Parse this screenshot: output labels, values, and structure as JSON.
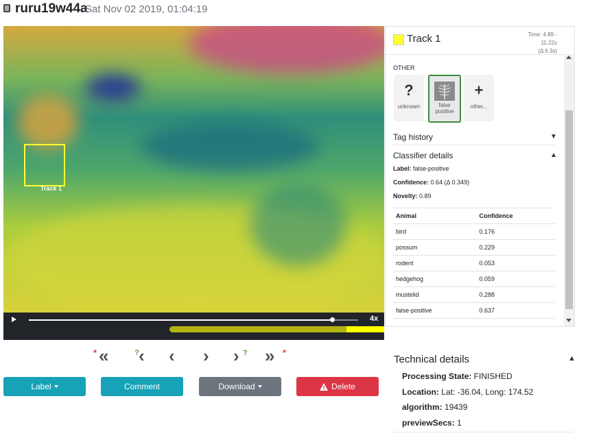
{
  "header": {
    "title": "ruru19w44a",
    "date": "Sat Nov 02 2019, 01:04:19"
  },
  "video": {
    "track_label": "Track 1",
    "speed": "4x",
    "playback_progress": 0.92
  },
  "nav": {
    "first": "«",
    "prev_track": "‹",
    "prev": "‹",
    "next": "›",
    "next_track": "›",
    "last": "»",
    "red_mark": "*",
    "green_mark": "?"
  },
  "buttons": {
    "label": "Label",
    "comment": "Comment",
    "download": "Download",
    "delete": "Delete"
  },
  "panel": {
    "track_title": "Track 1",
    "time_line1": "Time: 4.89 - 11.22s",
    "time_line2": "(Δ 6.3s)",
    "other_heading": "OTHER",
    "tags": [
      {
        "glyph": "?",
        "label": "unknown"
      },
      {
        "label_line1": "false",
        "label_line2": "positive"
      },
      {
        "glyph": "+",
        "label": "other..."
      }
    ],
    "tag_history": "Tag history",
    "classifier_details": "Classifier details",
    "label_key": "Label:",
    "label_val": "false-positive",
    "confidence_key": "Confidence:",
    "confidence_val": "0.64 (Δ 0.349)",
    "novelty_key": "Novelty:",
    "novelty_val": "0.89",
    "table": {
      "headers": [
        "Animal",
        "Confidence"
      ],
      "rows": [
        [
          "bird",
          "0.176"
        ],
        [
          "possum",
          "0.229"
        ],
        [
          "rodent",
          "0.053"
        ],
        [
          "hedgehog",
          "0.059"
        ],
        [
          "mustelid",
          "0.288"
        ],
        [
          "false-positive",
          "0.637"
        ]
      ]
    }
  },
  "technical": {
    "title": "Technical details",
    "processing_state_key": "Processing State:",
    "processing_state_val": "FINISHED",
    "location_key": "Location:",
    "location_val": "Lat: -36.04, Long: 174.52",
    "algorithm_key": "algorithm:",
    "algorithm_val": "19439",
    "preview_key": "previewSecs:",
    "preview_val": "1"
  },
  "colors": {
    "track": "#ffff33",
    "accent": "#17a2b8",
    "secondary": "#6c757d",
    "danger": "#dc3545",
    "selected_tag": "#3c8c3c"
  }
}
